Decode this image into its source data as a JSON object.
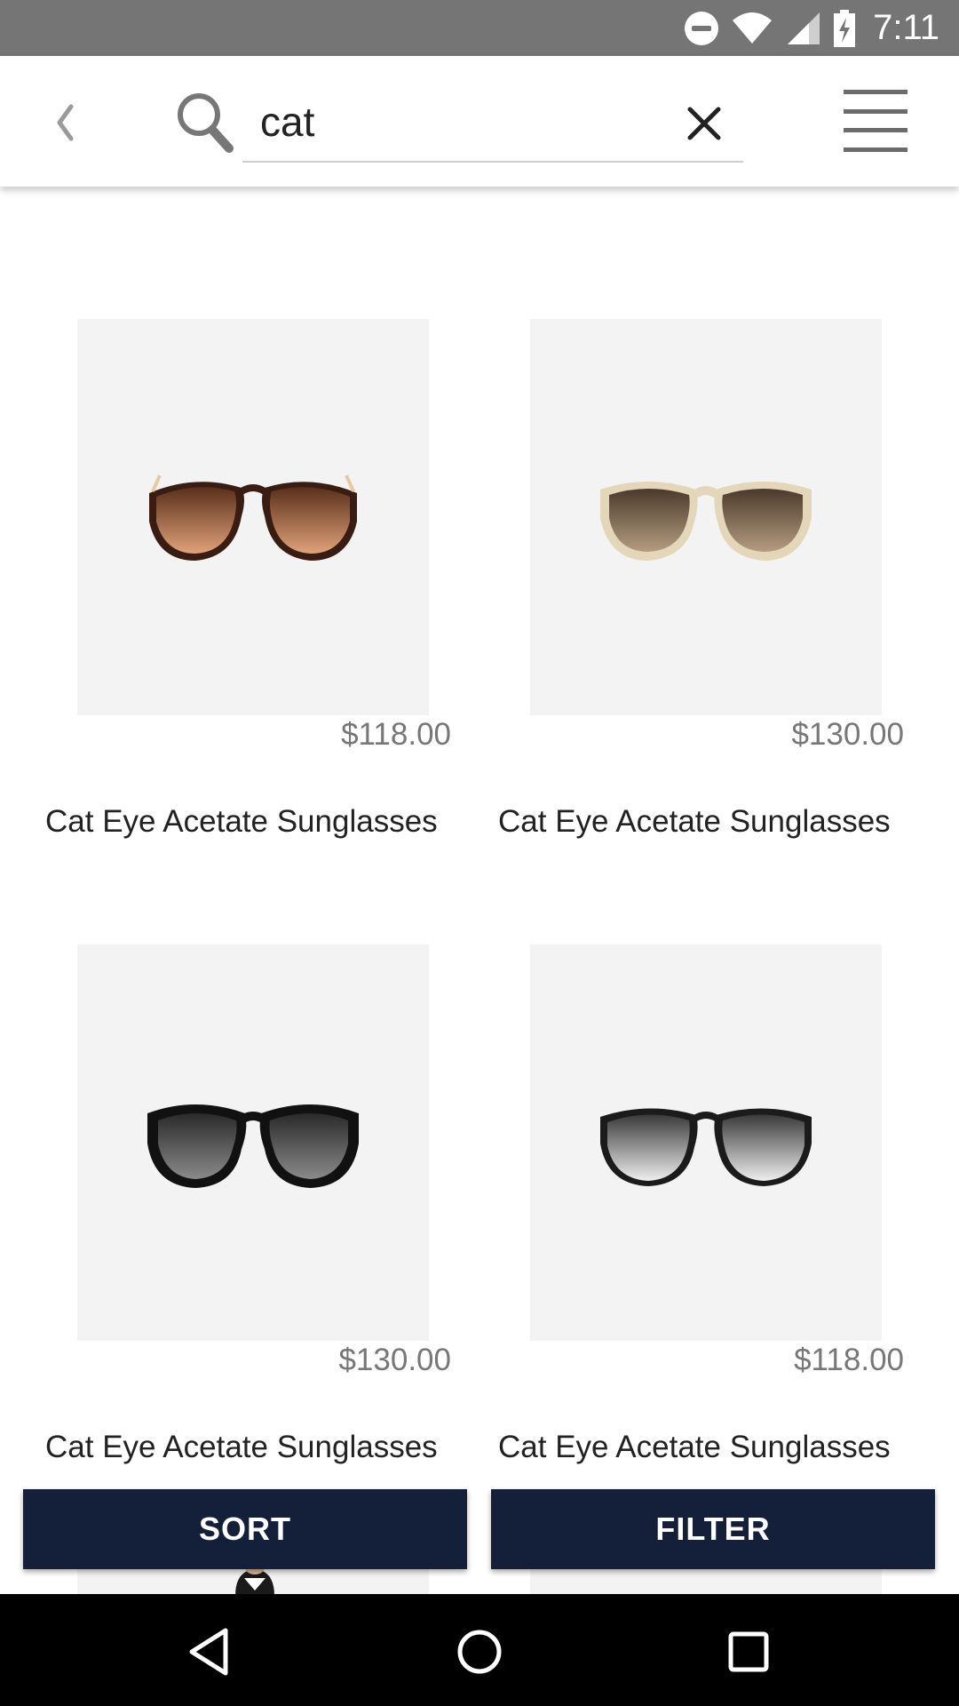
{
  "status_bar": {
    "time": "7:11",
    "icons": [
      "do-not-disturb-icon",
      "wifi-icon",
      "cell-signal-icon",
      "battery-charging-icon"
    ]
  },
  "app_bar": {
    "back_icon": "chevron-left-icon",
    "search_icon": "search-icon",
    "search": {
      "value": "cat",
      "placeholder": ""
    },
    "clear_icon": "close-icon",
    "menu_icon": "hamburger-menu-icon"
  },
  "products": [
    {
      "name": "Cat Eye Acetate Sunglasses",
      "price": "$118.00",
      "frame": "tortoise"
    },
    {
      "name": "Cat Eye Acetate Sunglasses",
      "price": "$130.00",
      "frame": "cream"
    },
    {
      "name": "Cat Eye Acetate Sunglasses",
      "price": "$130.00",
      "frame": "black"
    },
    {
      "name": "Cat Eye Acetate Sunglasses",
      "price": "$118.00",
      "frame": "black-gradient"
    }
  ],
  "actions": {
    "sort_label": "SORT",
    "filter_label": "FILTER"
  },
  "nav_bar": {
    "icons": [
      "nav-back-icon",
      "nav-home-icon",
      "nav-recents-icon"
    ]
  },
  "colors": {
    "status_bar": "#757575",
    "button_bg": "#14203a",
    "image_bg": "#f3f3f3",
    "price_text": "#777777"
  }
}
